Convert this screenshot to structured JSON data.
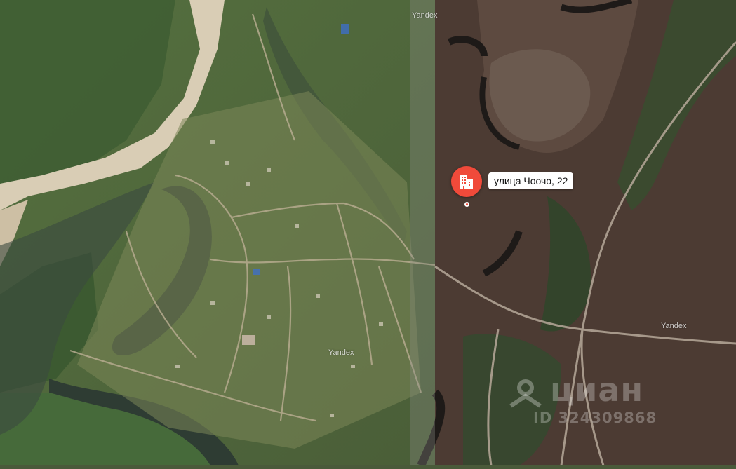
{
  "map": {
    "type": "satellite",
    "watermark_text": "Yandex"
  },
  "marker": {
    "icon": "building-icon",
    "color": "#f04a3a",
    "address": "улица Чоочо, 22"
  },
  "overlay_watermark": {
    "brand": "циан",
    "listing_id": "ID 324309868"
  },
  "colors": {
    "marker": "#f04a3a",
    "label_bg": "#ffffff"
  }
}
